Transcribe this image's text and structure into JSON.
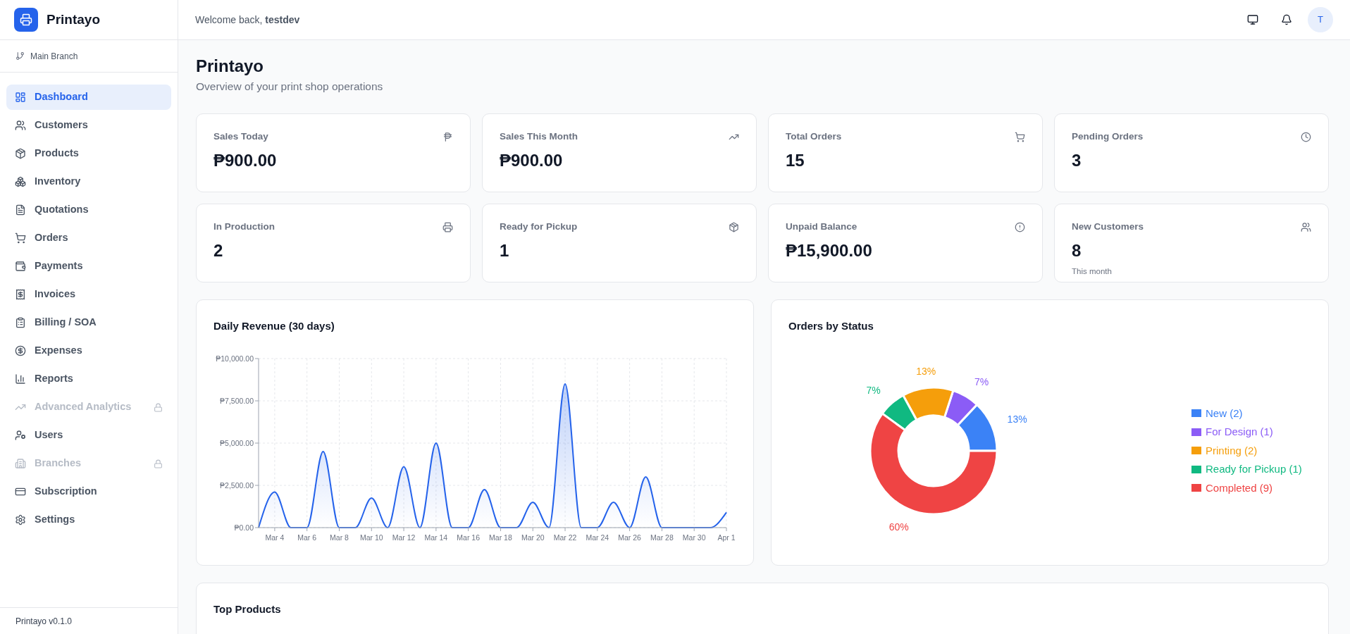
{
  "brand": {
    "name": "Printayo"
  },
  "branch": {
    "label": "Main Branch"
  },
  "sidebar": {
    "items": [
      {
        "label": "Dashboard",
        "selected": true,
        "disabled": false
      },
      {
        "label": "Customers",
        "selected": false,
        "disabled": false
      },
      {
        "label": "Products",
        "selected": false,
        "disabled": false
      },
      {
        "label": "Inventory",
        "selected": false,
        "disabled": false
      },
      {
        "label": "Quotations",
        "selected": false,
        "disabled": false
      },
      {
        "label": "Orders",
        "selected": false,
        "disabled": false
      },
      {
        "label": "Payments",
        "selected": false,
        "disabled": false
      },
      {
        "label": "Invoices",
        "selected": false,
        "disabled": false
      },
      {
        "label": "Billing / SOA",
        "selected": false,
        "disabled": false
      },
      {
        "label": "Expenses",
        "selected": false,
        "disabled": false
      },
      {
        "label": "Reports",
        "selected": false,
        "disabled": false
      },
      {
        "label": "Advanced Analytics",
        "selected": false,
        "disabled": true
      },
      {
        "label": "Users",
        "selected": false,
        "disabled": false
      },
      {
        "label": "Branches",
        "selected": false,
        "disabled": true
      },
      {
        "label": "Subscription",
        "selected": false,
        "disabled": false
      },
      {
        "label": "Settings",
        "selected": false,
        "disabled": false
      }
    ],
    "footer": "Printayo v0.1.0"
  },
  "header": {
    "welcome": "Welcome back, **testdev**",
    "avatar": "T"
  },
  "page": {
    "title": "Printayo",
    "subtitle": "Overview of your print shop operations"
  },
  "stats": [
    {
      "label": "Sales Today",
      "value": "₱900.00"
    },
    {
      "label": "Sales This Month",
      "value": "₱900.00"
    },
    {
      "label": "Total Orders",
      "value": "15"
    },
    {
      "label": "Pending Orders",
      "value": "3"
    },
    {
      "label": "In Production",
      "value": "2"
    },
    {
      "label": "Ready for Pickup",
      "value": "1"
    },
    {
      "label": "Unpaid Balance",
      "value": "₱15,900.00"
    },
    {
      "label": "New Customers",
      "value": "8",
      "note": "This month"
    }
  ],
  "revenue": {
    "title": "Daily Revenue (30 days)",
    "chart_data": {
      "type": "area",
      "categories": [
        null,
        "Mar 4",
        null,
        "Mar 6",
        null,
        "Mar 8",
        null,
        "Mar 10",
        null,
        "Mar 12",
        null,
        "Mar 14",
        null,
        "Mar 16",
        null,
        "Mar 18",
        null,
        "Mar 20",
        null,
        "Mar 22",
        null,
        "Mar 24",
        null,
        "Mar 26",
        null,
        "Mar 28",
        null,
        "Mar 30",
        null,
        "Apr 1"
      ],
      "grid": true,
      "series": [
        {
          "color": "#2563eb",
          "values": [
            0,
            2100,
            0,
            0,
            4500,
            0,
            0,
            1750,
            0,
            3600,
            0,
            5000,
            0,
            0,
            2250,
            0,
            0,
            1500,
            0,
            8500,
            0,
            0,
            1500,
            0,
            3000,
            0,
            0,
            0,
            0,
            900
          ]
        }
      ],
      "ylim": [
        0,
        10000
      ],
      "yticks": [
        {
          "value": 0,
          "label": "₱0.00"
        },
        {
          "value": 2500,
          "label": "₱2,500.00"
        },
        {
          "value": 5000,
          "label": "₱5,000.00"
        },
        {
          "value": 7500,
          "label": "₱7,500.00"
        },
        {
          "value": 10000,
          "label": "₱10,000.00"
        }
      ]
    }
  },
  "status": {
    "title": "Orders by Status",
    "chart_data": {
      "type": "donut",
      "categories": [
        "New (2)",
        "For Design (1)",
        "Printing (2)",
        "Ready for Pickup (1)",
        "Completed (9)"
      ],
      "values": [
        13,
        7,
        13,
        7,
        60
      ],
      "legend": true,
      "colors": [
        "#3b82f6",
        "#8b5cf6",
        "#f59e0b",
        "#10b981",
        "#ef4444"
      ],
      "value_labels": [
        "13%",
        "7%",
        "13%",
        "7%",
        "60%"
      ]
    }
  },
  "top_products": {
    "title": "Top Products"
  }
}
